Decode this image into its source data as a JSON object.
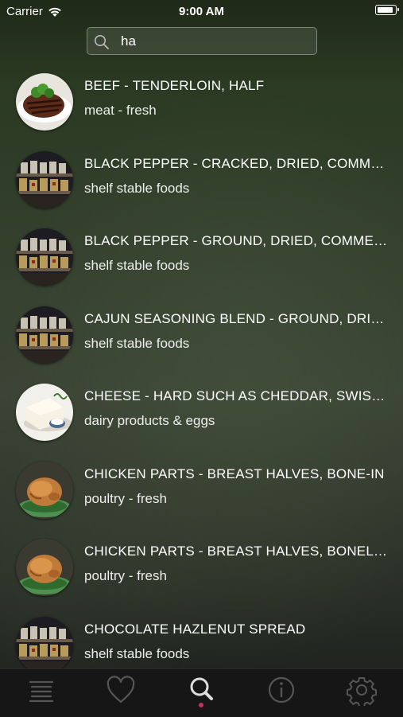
{
  "status_bar": {
    "carrier": "Carrier",
    "time": "9:00 AM"
  },
  "search": {
    "value": "ha",
    "icon": "search-icon"
  },
  "results": [
    {
      "title": "BEEF - TENDERLOIN, HALF",
      "category": "meat - fresh",
      "thumb": "steak"
    },
    {
      "title": "BLACK PEPPER - CRACKED, DRIED, COMMERCIALLY BOTTLED",
      "category": "shelf stable foods",
      "thumb": "spices"
    },
    {
      "title": "BLACK PEPPER - GROUND, DRIED, COMMERCIALLY BOTTLED",
      "category": "shelf stable foods",
      "thumb": "spices"
    },
    {
      "title": "CAJUN SEASONING BLEND  - GROUND, DRIED, COMMERCIALLY BOTTLED",
      "category": "shelf stable foods",
      "thumb": "spices"
    },
    {
      "title": "CHEESE - HARD SUCH AS CHEDDAR, SWISS, PARMESAN",
      "category": "dairy products & eggs",
      "thumb": "cheese"
    },
    {
      "title": "CHICKEN PARTS - BREAST HALVES, BONE-IN",
      "category": "poultry - fresh",
      "thumb": "chicken"
    },
    {
      "title": "CHICKEN PARTS - BREAST HALVES, BONELESS",
      "category": "poultry - fresh",
      "thumb": "chicken"
    },
    {
      "title": "CHOCOLATE HAZLENUT SPREAD",
      "category": "shelf stable foods",
      "thumb": "spices"
    }
  ],
  "tabbar": {
    "tabs": [
      "list-icon",
      "heart-icon",
      "search-icon",
      "info-icon",
      "gear-icon"
    ],
    "active": "search-icon",
    "active_indicator_color": "#c2335c"
  }
}
